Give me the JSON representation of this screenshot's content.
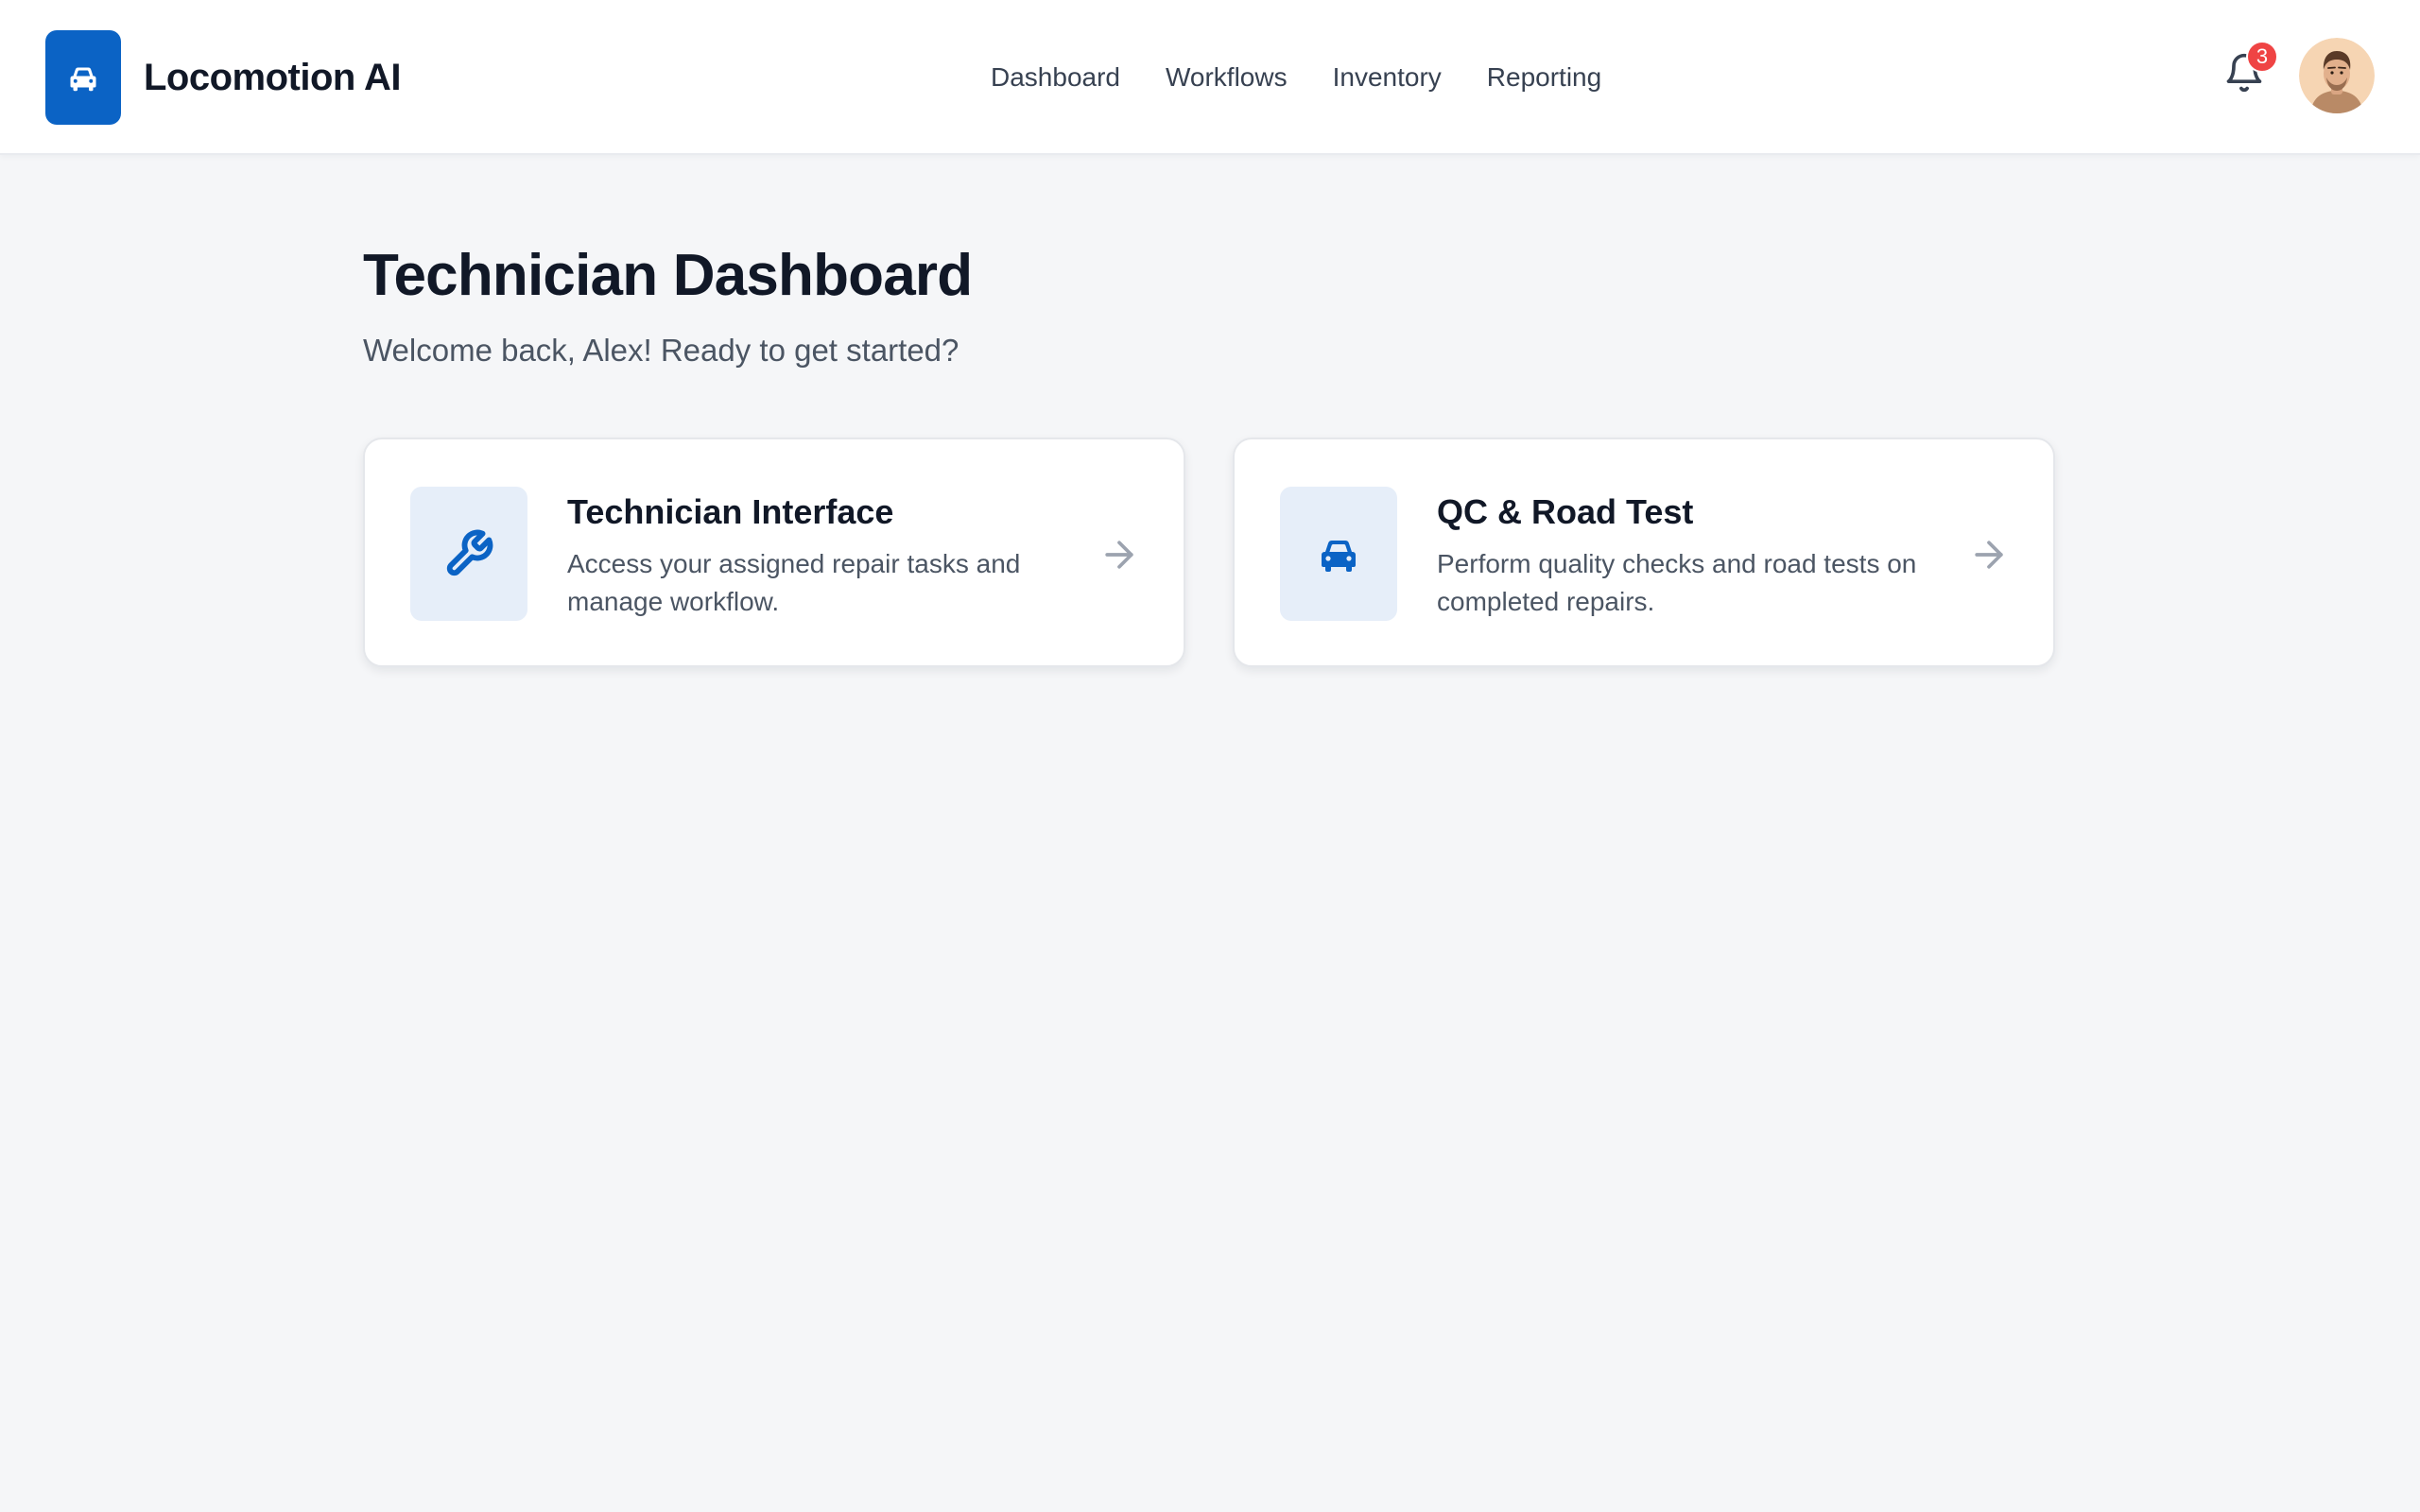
{
  "app": {
    "name": "Locomotion AI",
    "logo_icon": "car-icon",
    "brand_color": "#0b63c5"
  },
  "nav": {
    "items": [
      {
        "label": "Dashboard"
      },
      {
        "label": "Workflows"
      },
      {
        "label": "Inventory"
      },
      {
        "label": "Reporting"
      }
    ]
  },
  "header": {
    "notifications": {
      "icon": "bell-icon",
      "count": "3",
      "badge_color": "#ef4444"
    },
    "avatar": {
      "icon": "user-avatar"
    }
  },
  "main": {
    "title": "Technician Dashboard",
    "subtitle": "Welcome back, Alex! Ready to get started?",
    "cards": [
      {
        "icon": "wrench-icon",
        "title": "Technician Interface",
        "description": "Access your assigned repair tasks and manage workflow.",
        "action_icon": "arrow-right-icon"
      },
      {
        "icon": "car-icon",
        "title": "QC & Road Test",
        "description": "Perform quality checks and road tests on completed repairs.",
        "action_icon": "arrow-right-icon"
      }
    ]
  }
}
